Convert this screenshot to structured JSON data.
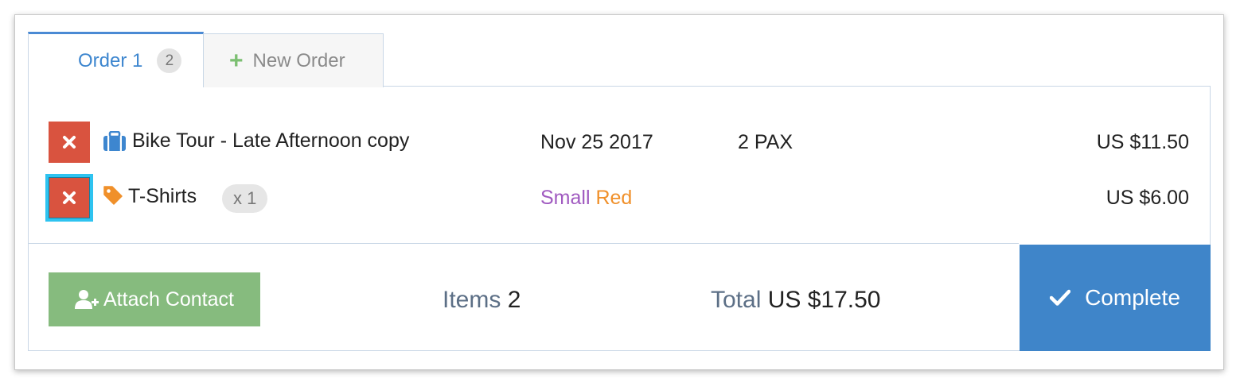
{
  "tabs": [
    {
      "label": "Order 1",
      "badge": "2"
    },
    {
      "label": "New Order",
      "icon": "plus-icon"
    }
  ],
  "order_items": [
    {
      "icon": "briefcase-icon",
      "name": "Bike Tour - Late Afternoon copy",
      "date": "Nov 25 2017",
      "pax": "2 PAX",
      "price": "US $11.50"
    },
    {
      "icon": "tag-icon",
      "name": "T-Shirts",
      "quantity": "x 1",
      "variant_size": "Small",
      "variant_color": "Red",
      "price": "US $6.00"
    }
  ],
  "footer": {
    "attach_contact_label": "Attach Contact",
    "items_label": "Items",
    "items_count": "2",
    "total_label": "Total",
    "total_value": "US $17.50",
    "complete_label": "Complete"
  },
  "colors": {
    "active_tab": "#3d86cf",
    "delete_button": "#d9533f",
    "attach_button": "#86bb7e",
    "complete_button": "#3f85c9",
    "variant_size": "#a05ac0",
    "variant_color": "#f0902a",
    "focus_ring": "#2ec3f0"
  }
}
